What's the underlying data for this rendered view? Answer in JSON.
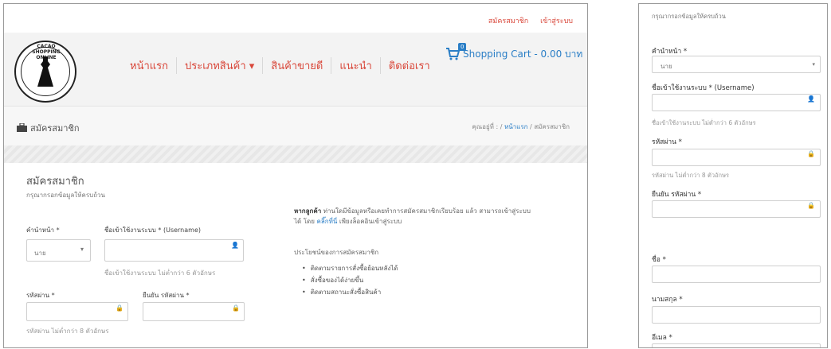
{
  "top_links": {
    "register": "สมัครสมาชิก",
    "login": "เข้าสู่ระบบ"
  },
  "logo": {
    "brand_text": "CACAO SHOPPING ONLINE"
  },
  "nav": [
    "หน้าแรก",
    "ประเภทสินค้า ▾",
    "สินค้าขายดี",
    "แนะนำ",
    "ติดต่อเรา"
  ],
  "cart": {
    "count": "0",
    "label": "Shopping Cart - 0.00 บาท"
  },
  "page_header": {
    "title": "สมัครสมาชิก",
    "breadcrumb_prefix": "คุณอยู่ที่ :",
    "breadcrumb_home": "หน้าแรก",
    "breadcrumb_sep": "/",
    "breadcrumb_current": "สมัครสมาชิก"
  },
  "form": {
    "heading": "สมัครสมาชิก",
    "instruction": "กรุณากรอกข้อมูลให้ครบถ้วน",
    "title_label": "คำนำหน้า *",
    "title_value": "นาย",
    "username_label": "ชื่อเข้าใช้งานระบบ * (Username)",
    "username_help": "ชื่อเข้าใช้งานระบบ ไม่ต่ำกว่า 6 ตัวอักษร",
    "password_label": "รหัสผ่าน *",
    "password_help": "รหัสผ่าน ไม่ต่ำกว่า 8 ตัวอักษร",
    "confirm_label": "ยืนยัน รหัสผ่าน *",
    "firstname_label": "ชื่อ *",
    "lastname_label": "นามสกุล *",
    "email_label": "อีเมล *"
  },
  "info": {
    "customer_bold": "หากลูกค้า",
    "customer_text": "ท่านใดมีข้อมูลหรือเคยทำการสมัครสมาชิกเรียบร้อย แล้ว สามารถเข้าสู่ระบบได้ โดย",
    "click_link": "คลิ๊กที่นี่",
    "after_link": "เพียงล็อคอินเข้าสู่ระบบ",
    "benefits_title": "ประโยชน์ของการสมัครสมาชิก",
    "benefits": [
      "ติดตามรายการสั่งซื้อย้อนหลังได้",
      "สั่งซื้อของได้ง่ายขึ้น",
      "ติดตามสถานะสั่งซื้อสินค้า"
    ]
  },
  "colors": {
    "accent_red": "#d9473a",
    "link_blue": "#2a7ec6"
  }
}
